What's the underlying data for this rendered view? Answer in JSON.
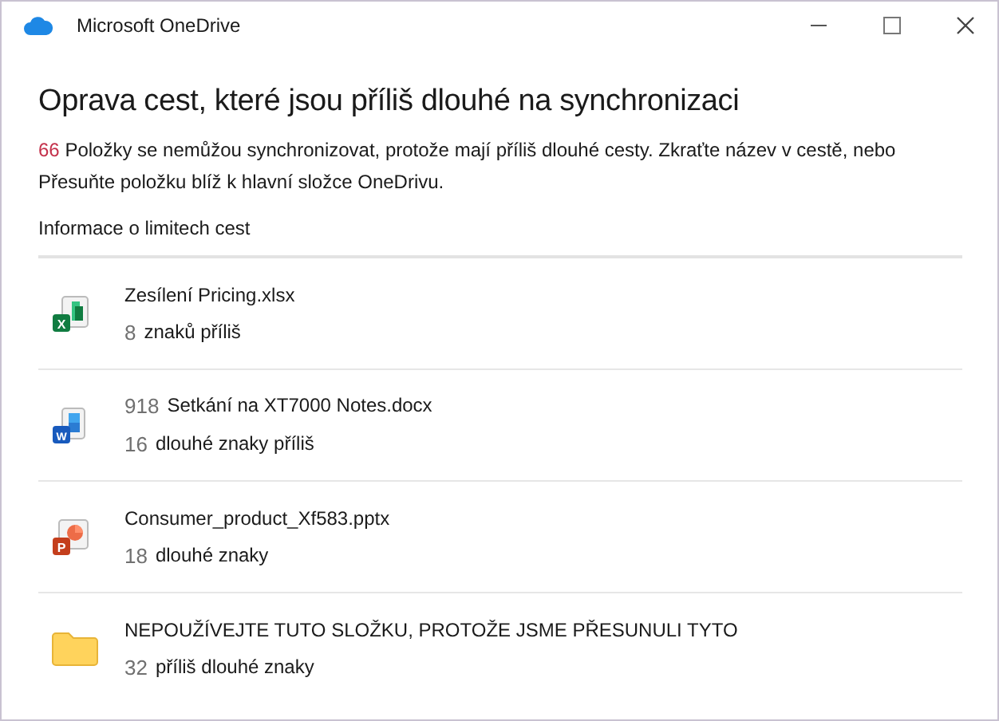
{
  "window": {
    "title": "Microsoft OneDrive"
  },
  "heading": "Oprava cest, které jsou příliš dlouhé na synchronizaci",
  "summary": {
    "count": "66",
    "text": "Položky se nemůžou synchronizovat, protože mají příliš dlouhé cesty. Zkraťte název v cestě, nebo Přesuňte položku blíž k hlavní složce OneDrivu."
  },
  "link": "Informace o limitech cest",
  "items": [
    {
      "kind": "excel",
      "badge": "X",
      "name": "Zesílení Pricing.xlsx",
      "count": "8",
      "detail": "znaků příliš"
    },
    {
      "kind": "word",
      "badge": "W",
      "prefix": "918",
      "name": "Setkání na XT7000 Notes.docx",
      "count": "16",
      "detail": "dlouhé znaky příliš"
    },
    {
      "kind": "powerpoint",
      "badge": "P",
      "name": "Consumer_product_Xf583.pptx",
      "count": "18",
      "detail": "dlouhé znaky"
    },
    {
      "kind": "folder",
      "name": "NEPOUŽÍVEJTE TUTO SLOŽKU, PROTOŽE JSME PŘESUNULI TYTO",
      "count": "32",
      "detail": "příliš dlouhé znaky"
    }
  ]
}
